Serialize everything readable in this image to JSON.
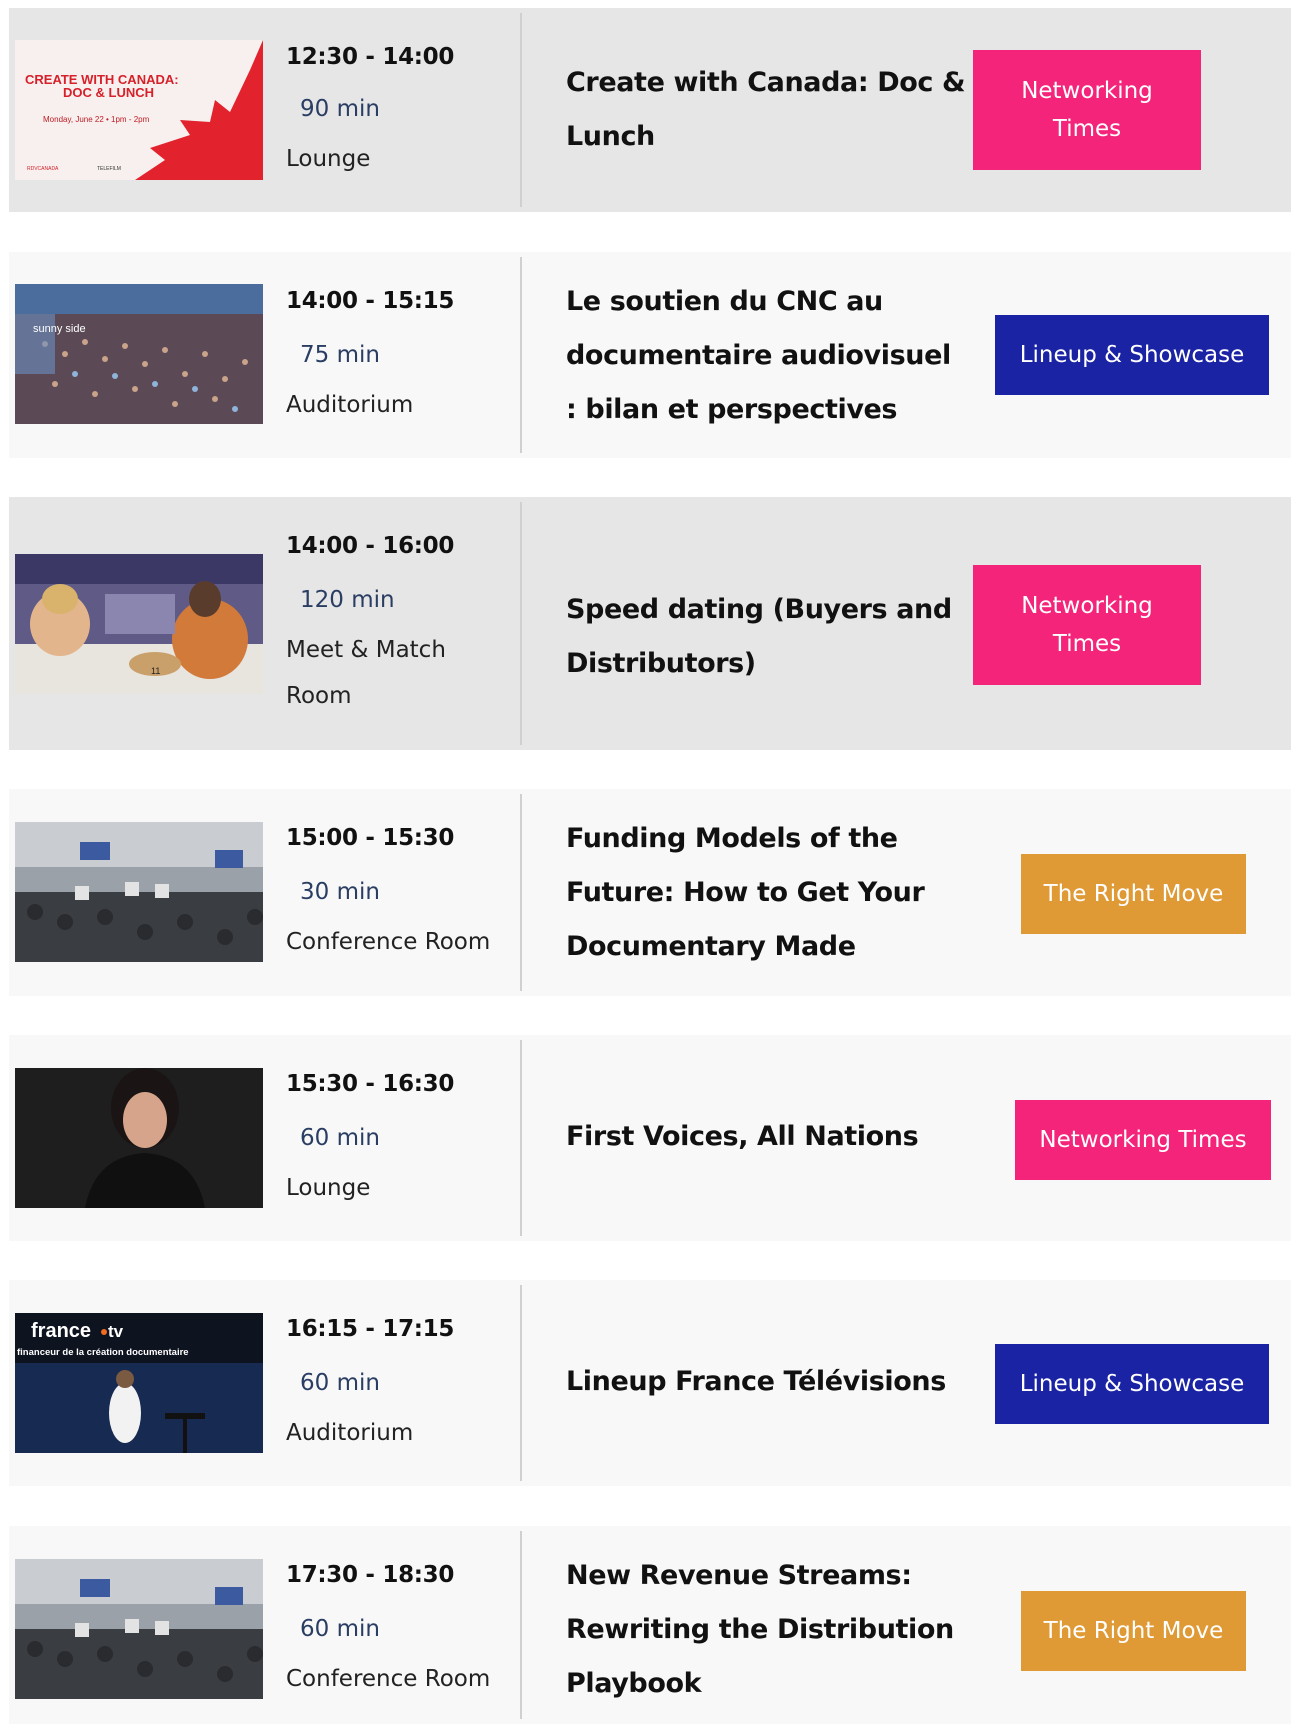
{
  "sessions": [
    {
      "time": "12:30 - 14:00",
      "duration": "90 min",
      "room": "Lounge",
      "title": "Create with Canada: Doc & Lunch",
      "tag": "Networking Times",
      "thumb": {
        "line1": "CREATE WITH CANADA:",
        "line2": "DOC & LUNCH",
        "line3": "Monday, June 22 • 1pm - 2pm",
        "logo": "RDVCANADA",
        "logo2": "TELEFILM"
      }
    },
    {
      "time": "14:00 - 15:15",
      "duration": "75 min",
      "room": "Auditorium",
      "title": "Le soutien du CNC au documentaire audiovisuel : bilan et perspectives",
      "tag": "Lineup & Showcase",
      "thumb": {
        "sign": "sunny side"
      }
    },
    {
      "time": "14:00 - 16:00",
      "duration": "120 min",
      "room": "Meet & Match Room",
      "title": "Speed dating (Buyers and Distributors)",
      "tag": "Networking Times",
      "thumb": {
        "number": "11"
      }
    },
    {
      "time": "15:00 - 15:30",
      "duration": "30 min",
      "room": "Conference Room",
      "title": "Funding Models of the Future: How to Get Your Documentary Made",
      "tag": "The Right Move"
    },
    {
      "time": "15:30 - 16:30",
      "duration": "60 min",
      "room": "Lounge",
      "title": "First Voices, All Nations",
      "tag": "Networking Times"
    },
    {
      "time": "16:15 - 17:15",
      "duration": "60 min",
      "room": "Auditorium",
      "title": "Lineup France Télévisions",
      "tag": "Lineup & Showcase",
      "thumb": {
        "brand": "france",
        "brand2": "tv",
        "slogan": "financeur de la création documentaire"
      }
    },
    {
      "time": "17:30 - 18:30",
      "duration": "60 min",
      "room": "Conference Room",
      "title": "New Revenue Streams: Rewriting the Distribution Playbook",
      "tag": "The Right Move"
    }
  ],
  "colors": {
    "networking": "#f4247a",
    "lineup": "#1a23a3",
    "right_move": "#df9a36"
  }
}
